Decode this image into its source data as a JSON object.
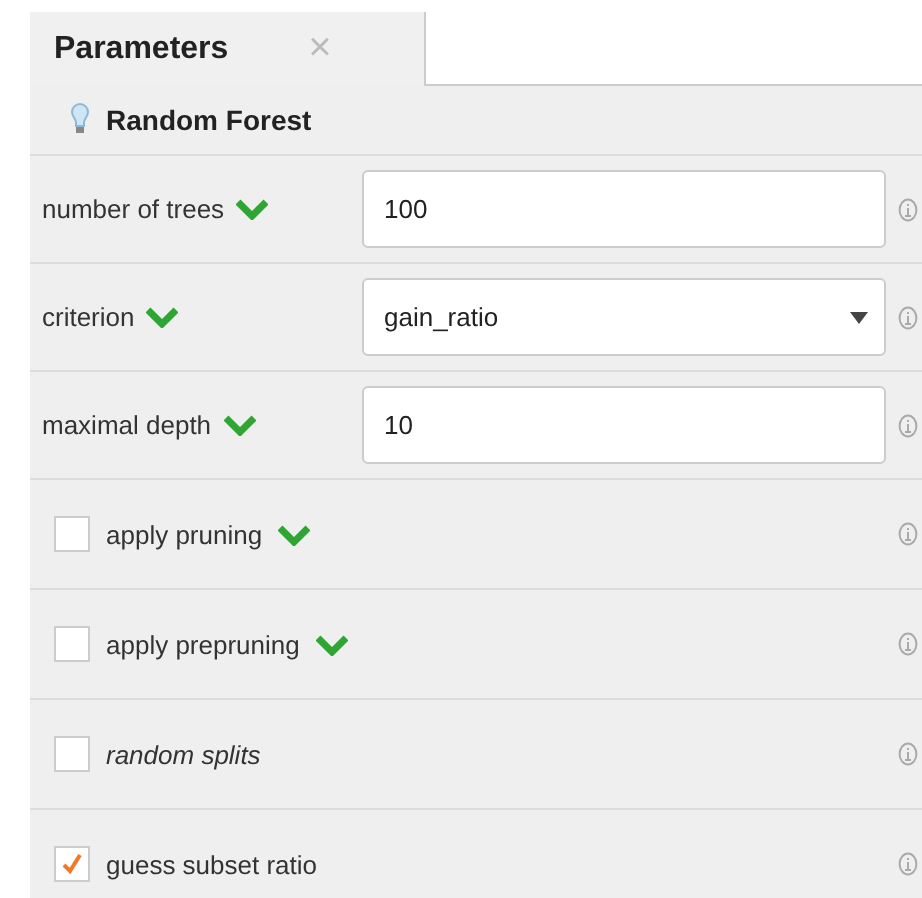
{
  "tab": {
    "label": "Parameters",
    "close": "×",
    "selected": true
  },
  "operator": {
    "name": "Random Forest"
  },
  "parameters": [
    {
      "kind": "text",
      "label": "number of trees",
      "important": true,
      "expert": false,
      "value": "100"
    },
    {
      "kind": "select",
      "label": "criterion",
      "important": true,
      "expert": false,
      "value": "gain_ratio"
    },
    {
      "kind": "text",
      "label": "maximal depth",
      "important": true,
      "expert": false,
      "value": "10"
    },
    {
      "kind": "checkbox",
      "label": "apply pruning",
      "important": true,
      "expert": false,
      "checked": false
    },
    {
      "kind": "checkbox",
      "label": "apply prepruning",
      "important": true,
      "expert": false,
      "checked": false
    },
    {
      "kind": "checkbox",
      "label": "random splits",
      "important": false,
      "expert": true,
      "checked": false
    },
    {
      "kind": "checkbox",
      "label": "guess subset ratio",
      "important": false,
      "expert": false,
      "checked": true
    }
  ]
}
